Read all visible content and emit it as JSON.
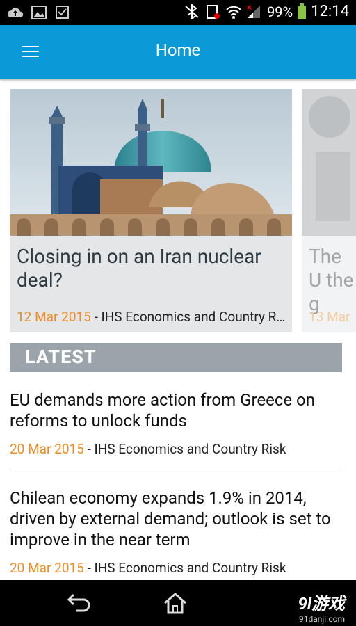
{
  "statusbar": {
    "battery": "99%",
    "time": "12:14"
  },
  "appbar": {
    "title": "Home"
  },
  "cards": [
    {
      "headline": "Closing in on an Iran nuclear deal?",
      "date": "12 Mar 2015",
      "source": " - IHS Economics and Country Risk"
    },
    {
      "headline": "The U the g",
      "date": "13 Mar"
    }
  ],
  "latest": {
    "label": "LATEST"
  },
  "articles": [
    {
      "title": "EU demands more action from Greece on reforms to unlock funds",
      "date": "20 Mar 2015",
      "source": " - IHS Economics and Country Risk"
    },
    {
      "title": "Chilean economy expands 1.9% in 2014, driven by external demand; outlook is set to improve in the near term",
      "date": "20 Mar 2015",
      "source": " - IHS Economics and Country Risk"
    }
  ],
  "watermark": {
    "logo": "9l游戏",
    "url": "91danji.com"
  },
  "colors": {
    "appbar": "#0b9ad8",
    "date_accent": "#ef8b1f",
    "latest_bar": "#9ba4aa"
  }
}
